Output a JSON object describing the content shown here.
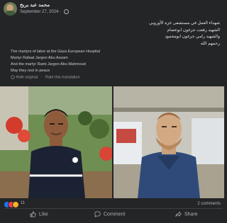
{
  "post": {
    "author": "محمد عبد بربخ",
    "date": "September 27, 2024",
    "arabic_lines": [
      "شهداء العمل في مستشفى غزة الأوروبي",
      "الشهيد رفعت جرغون ابوعصام",
      "والشهيد رامي جرغون ابومحمود",
      "رحمهم الله"
    ],
    "english_lines": [
      "The martyrs of labor at the Gaza European Hospital",
      "Martyr Rafaat Jargon Abu Assam",
      "And the martyr Rami Jargon Abu Mahmoud",
      "May they rest in peace"
    ],
    "hide_original": "Hide original",
    "rate_translation": "Rate this translation"
  },
  "stats": {
    "reaction_count": "11",
    "comments": "2 comments"
  },
  "actions": {
    "like": "Like",
    "comment": "Comment",
    "share": "Share"
  },
  "colors": {
    "background": "#242526",
    "text": "#e4e6eb",
    "muted": "#b0b3b8",
    "like_blue": "#1877f2"
  },
  "icons": [
    "globe-icon",
    "like-icon",
    "comment-icon",
    "share-icon"
  ]
}
